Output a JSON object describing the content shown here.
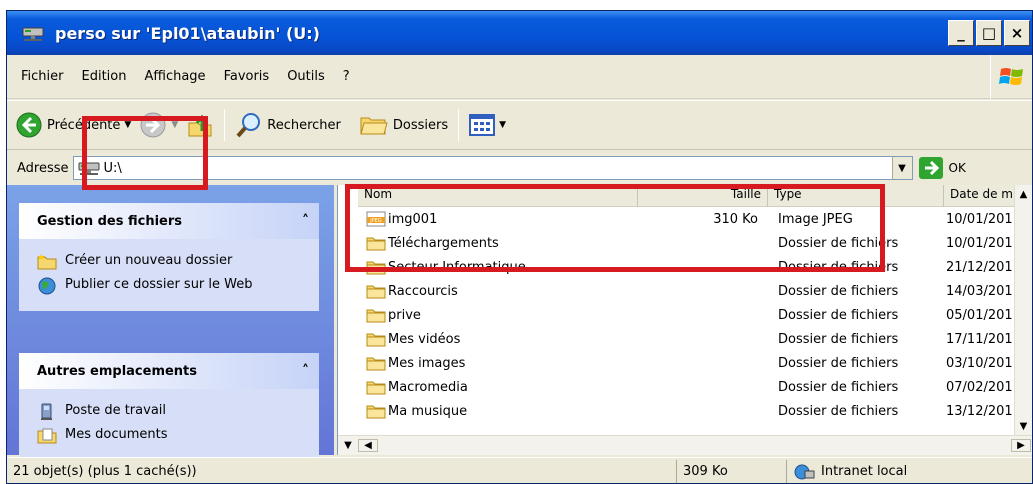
{
  "window": {
    "title": "perso sur 'Epl01\\ataubin' (U:)",
    "buttons": {
      "minimize": "_",
      "maximize": "□",
      "close": "×"
    }
  },
  "menu": {
    "items": [
      "Fichier",
      "Edition",
      "Affichage",
      "Favoris",
      "Outils",
      "?"
    ]
  },
  "toolbar": {
    "back_label": "Précédente",
    "search_label": "Rechercher",
    "folders_label": "Dossiers"
  },
  "address": {
    "label": "Adresse",
    "value": "U:\\",
    "go_label": "OK"
  },
  "left_panel": {
    "file_tasks": {
      "title": "Gestion des fichiers",
      "items": [
        "Créer un nouveau dossier",
        "Publier ce dossier sur le Web"
      ]
    },
    "other_places": {
      "title": "Autres emplacements",
      "items": [
        "Poste de travail",
        "Mes documents"
      ]
    }
  },
  "filelist": {
    "columns": [
      "Nom",
      "Taille",
      "Type",
      "Date de m"
    ],
    "rows": [
      {
        "name": "img001",
        "size": "310 Ko",
        "type": "Image JPEG",
        "date": "10/01/201",
        "icon": "jpeg-icon"
      },
      {
        "name": "Téléchargements",
        "size": "",
        "type": "Dossier de fichiers",
        "date": "10/01/201",
        "icon": "folder-icon"
      },
      {
        "name": "Secteur Informatique",
        "size": "",
        "type": "Dossier de fichiers",
        "date": "21/12/201",
        "icon": "folder-icon"
      },
      {
        "name": "Raccourcis",
        "size": "",
        "type": "Dossier de fichiers",
        "date": "14/03/201",
        "icon": "folder-icon"
      },
      {
        "name": "prive",
        "size": "",
        "type": "Dossier de fichiers",
        "date": "05/01/201",
        "icon": "folder-icon"
      },
      {
        "name": "Mes vidéos",
        "size": "",
        "type": "Dossier de fichiers",
        "date": "17/11/201",
        "icon": "folder-icon"
      },
      {
        "name": "Mes images",
        "size": "",
        "type": "Dossier de fichiers",
        "date": "03/10/201",
        "icon": "folder-icon"
      },
      {
        "name": "Macromedia",
        "size": "",
        "type": "Dossier de fichiers",
        "date": "07/02/201",
        "icon": "folder-icon"
      },
      {
        "name": "Ma musique",
        "size": "",
        "type": "Dossier de fichiers",
        "date": "13/12/201",
        "icon": "folder-icon"
      }
    ]
  },
  "status": {
    "objects": "21 objet(s) (plus 1 caché(s))",
    "size": "309 Ko",
    "zone": "Intranet local"
  },
  "colors": {
    "titlebar": "#0553d6",
    "annotation": "#d71920",
    "panel_bg": "#6375d6",
    "panel_card": "#d6dff7"
  }
}
